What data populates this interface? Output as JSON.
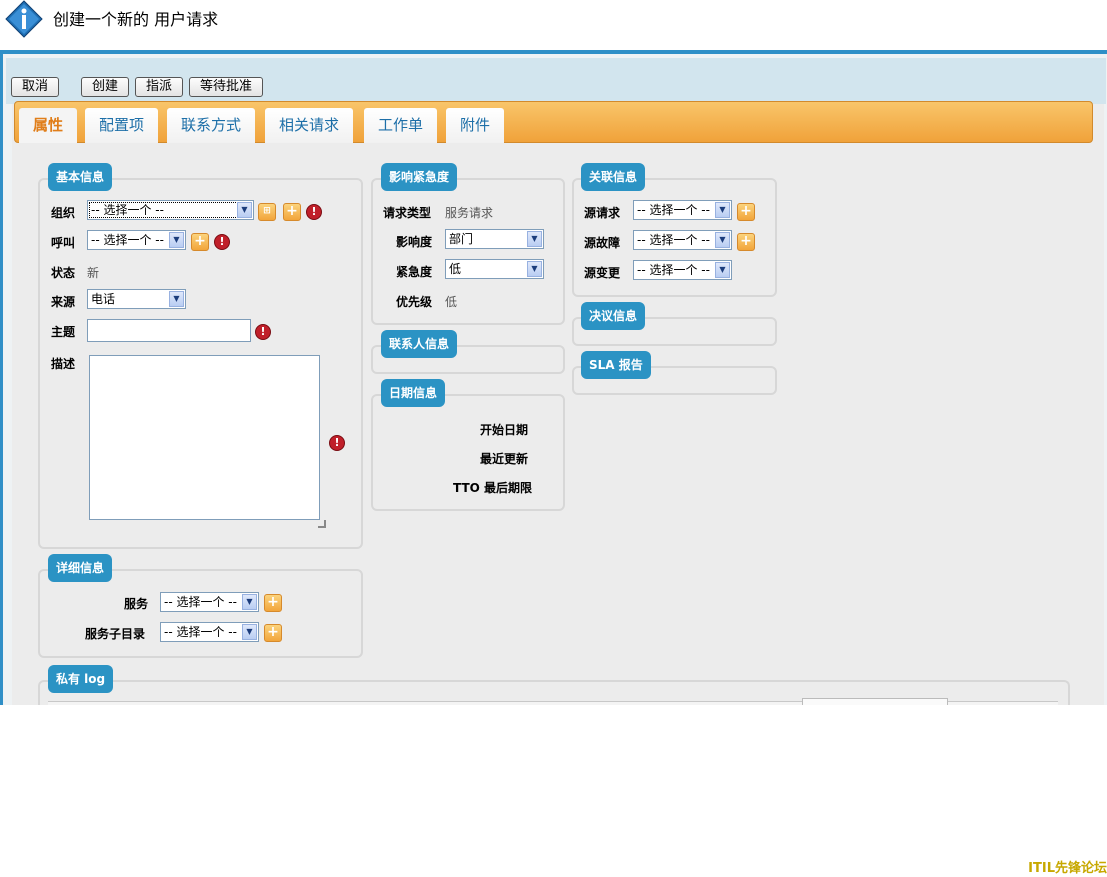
{
  "page": {
    "title": "创建一个新的 用户请求"
  },
  "toolbar": {
    "cancel": "取消",
    "create": "创建",
    "assign": "指派",
    "wait_approval": "等待批准"
  },
  "tabs": [
    "属性",
    "配置项",
    "联系方式",
    "相关请求",
    "工作单",
    "附件"
  ],
  "basic": {
    "legend": "基本信息",
    "org_label": "组织",
    "org_value": "-- 选择一个 --",
    "caller_label": "呼叫",
    "caller_value": "-- 选择一个 --",
    "status_label": "状态",
    "status_value": "新",
    "source_label": "来源",
    "source_value": "电话",
    "subject_label": "主题",
    "desc_label": "描述"
  },
  "impact": {
    "legend": "影响紧急度",
    "type_label": "请求类型",
    "type_value": "服务请求",
    "impact_label": "影响度",
    "impact_value": "部门",
    "urgency_label": "紧急度",
    "urgency_value": "低",
    "priority_label": "优先级",
    "priority_value": "低"
  },
  "contact": {
    "legend": "联系人信息"
  },
  "dates": {
    "legend": "日期信息",
    "start": "开始日期",
    "last_update": "最近更新",
    "tto": "TTO 最后期限"
  },
  "related": {
    "legend": "关联信息",
    "src_request": "源请求",
    "src_incident": "源故障",
    "src_change": "源变更",
    "placeholder": "-- 选择一个 --"
  },
  "resolution": {
    "legend": "决议信息"
  },
  "sla": {
    "legend": "SLA 报告"
  },
  "details": {
    "legend": "详细信息",
    "service_label": "服务",
    "service_value": "-- 选择一个 --",
    "subcat_label": "服务子目录",
    "subcat_value": "-- 选择一个 --"
  },
  "private_log": {
    "legend": "私有 log"
  },
  "watermark": "ITIL先锋论坛",
  "colors": {
    "accent": "#2b93c4",
    "tab_bar": "#f0a23a",
    "alert": "#c0202a"
  }
}
